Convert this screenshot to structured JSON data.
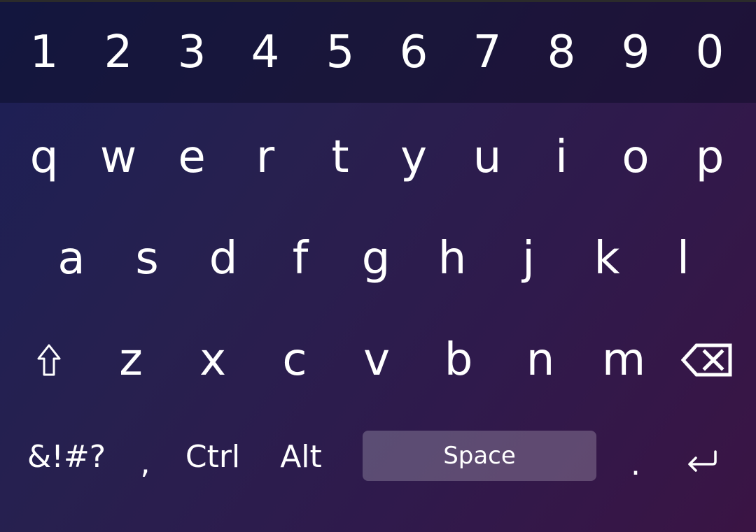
{
  "keyboard": {
    "number_row": [
      "1",
      "2",
      "3",
      "4",
      "5",
      "6",
      "7",
      "8",
      "9",
      "0"
    ],
    "qwerty_row": [
      "q",
      "w",
      "e",
      "r",
      "t",
      "y",
      "u",
      "i",
      "o",
      "p"
    ],
    "home_row": [
      "a",
      "s",
      "d",
      "f",
      "g",
      "h",
      "j",
      "k",
      "l"
    ],
    "bottom_row": {
      "shift_icon": "shift-icon",
      "letters": [
        "z",
        "x",
        "c",
        "v",
        "b",
        "n",
        "m"
      ],
      "backspace_icon": "backspace-icon"
    },
    "function_row": {
      "symbols_label": "&!#?",
      "comma_label": ",",
      "ctrl_label": "Ctrl",
      "alt_label": "Alt",
      "space_label": "Space",
      "period_label": ".",
      "enter_icon": "enter-icon"
    }
  },
  "colors": {
    "gradient_start": "#1c1f55",
    "gradient_end": "#3a1444",
    "key_text": "#ffffff",
    "space_key_bg": "rgba(255,255,255,0.22)"
  }
}
